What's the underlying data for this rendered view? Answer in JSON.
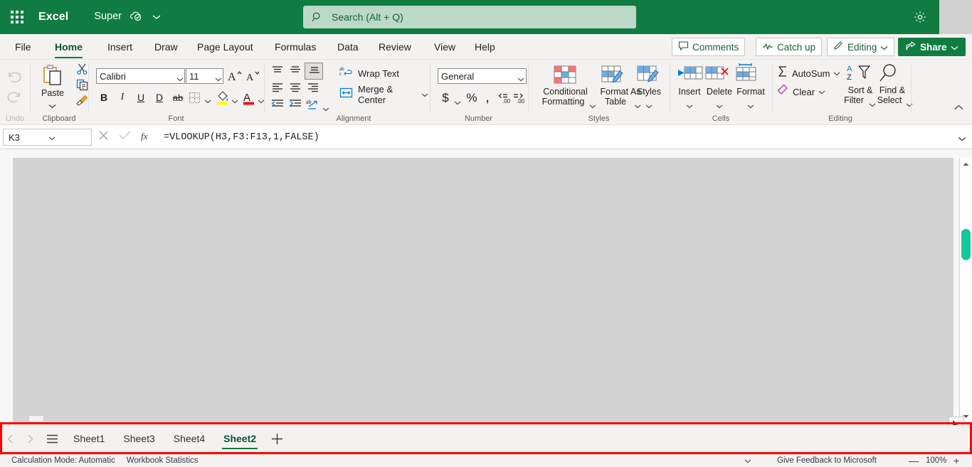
{
  "titlebar": {
    "app_name": "Excel",
    "document_name": "Super",
    "waffle_icon": "app-launcher-icon",
    "cloud_icon": "cloud-saved-icon",
    "caret_icon": "chevron-down-icon",
    "gear_icon": "settings-gear-icon",
    "brand_color": "#107c41"
  },
  "search": {
    "placeholder": "Search (Alt + Q)",
    "value": "",
    "icon": "search-icon"
  },
  "ribbon_tabs": [
    {
      "label": "File",
      "active": false
    },
    {
      "label": "Home",
      "active": true
    },
    {
      "label": "Insert",
      "active": false
    },
    {
      "label": "Draw",
      "active": false
    },
    {
      "label": "Page Layout",
      "active": false
    },
    {
      "label": "Formulas",
      "active": false
    },
    {
      "label": "Data",
      "active": false
    },
    {
      "label": "Review",
      "active": false
    },
    {
      "label": "View",
      "active": false
    },
    {
      "label": "Help",
      "active": false
    }
  ],
  "header_actions": {
    "comments": "Comments",
    "comments_icon": "comment-bubble-icon",
    "catch_up": "Catch up",
    "catch_up_icon": "activity-pulse-icon",
    "editing": "Editing",
    "editing_icon": "pencil-icon",
    "editing_caret": "chevron-down-icon",
    "share": "Share",
    "share_icon": "share-arrow-icon",
    "share_caret": "chevron-down-icon"
  },
  "ribbon": {
    "undo": {
      "group_label": "Undo",
      "undo_icon": "undo-arrow-icon",
      "redo_icon": "redo-arrow-icon"
    },
    "clipboard": {
      "group_label": "Clipboard",
      "paste_label": "Paste",
      "paste_icon": "paste-clipboard-icon",
      "paste_caret": "chevron-down-icon",
      "cut_icon": "scissors-icon",
      "copy_icon": "copy-pages-icon",
      "format_painter_icon": "format-painter-brush-icon"
    },
    "font": {
      "group_label": "Font",
      "font_family": "Calibri",
      "font_size": "11",
      "grow_font_icon": "increase-font-size-icon",
      "shrink_font_icon": "decrease-font-size-icon",
      "bold": "B",
      "italic": "I",
      "underline": "U",
      "double_underline": "D",
      "strikethrough": "ab",
      "borders_icon": "borders-icon",
      "borders_caret": "chevron-down-icon",
      "fill_color_icon": "fill-color-bucket-icon",
      "fill_color_caret": "chevron-down-icon",
      "fill_color_value": "#ffff00",
      "font_color_icon": "font-color-icon",
      "font_color_caret": "chevron-down-icon",
      "font_color_value": "#e81123"
    },
    "alignment": {
      "group_label": "Alignment",
      "align_top_icon": "align-top-icon",
      "align_middle_icon": "align-middle-icon",
      "align_bottom_icon": "align-bottom-icon",
      "align_left_icon": "align-left-icon",
      "align_center_icon": "align-center-icon",
      "align_right_icon": "align-right-icon",
      "decrease_indent_icon": "decrease-indent-icon",
      "increase_indent_icon": "increase-indent-icon",
      "orientation_icon": "text-orientation-icon",
      "orientation_caret": "chevron-down-icon",
      "wrap_text": "Wrap Text",
      "wrap_text_icon": "wrap-text-icon",
      "merge_center": "Merge & Center",
      "merge_center_icon": "merge-cells-icon",
      "merge_caret": "chevron-down-icon"
    },
    "number": {
      "group_label": "Number",
      "format": "General",
      "currency_icon": "currency-dollar-icon",
      "currency_caret": "chevron-down-icon",
      "percent_icon": "percent-style-icon",
      "comma_icon": "comma-style-icon",
      "increase_decimal_icon": "increase-decimal-icon",
      "decrease_decimal_icon": "decrease-decimal-icon"
    },
    "styles": {
      "group_label": "Styles",
      "conditional_formatting_line1": "Conditional",
      "conditional_formatting_line2": "Formatting",
      "conditional_formatting_icon": "conditional-formatting-icon",
      "conditional_caret": "chevron-down-icon",
      "format_as_table_line1": "Format As",
      "format_as_table_line2": "Table",
      "format_as_table_icon": "format-as-table-icon",
      "format_table_caret": "chevron-down-icon",
      "cell_styles": "Styles",
      "cell_styles_icon": "cell-styles-icon",
      "cell_styles_caret": "chevron-down-icon"
    },
    "cells": {
      "group_label": "Cells",
      "insert": "Insert",
      "insert_icon": "insert-cells-icon",
      "insert_caret": "chevron-down-icon",
      "delete": "Delete",
      "delete_icon": "delete-cells-icon",
      "delete_caret": "chevron-down-icon",
      "format": "Format",
      "format_icon": "format-cells-icon",
      "format_caret": "chevron-down-icon"
    },
    "editing": {
      "group_label": "Editing",
      "autosum": "AutoSum",
      "autosum_icon": "sigma-autosum-icon",
      "autosum_caret": "chevron-down-icon",
      "clear": "Clear",
      "clear_icon": "eraser-clear-icon",
      "clear_caret": "chevron-down-icon",
      "sort_filter_line1": "Sort &",
      "sort_filter_line2": "Filter",
      "sort_filter_icon": "sort-filter-icon",
      "sort_filter_caret": "chevron-down-icon",
      "find_select_line1": "Find &",
      "find_select_line2": "Select",
      "find_select_icon": "find-select-magnifier-icon",
      "find_select_caret": "chevron-down-icon"
    },
    "collapse_icon": "chevron-up-icon"
  },
  "formula_bar": {
    "name_box": "K3",
    "name_box_caret": "chevron-down-icon",
    "cancel_icon": "cancel-x-icon",
    "confirm_icon": "confirm-check-icon",
    "fx_icon": "insert-function-fx-icon",
    "formula": "=VLOOKUP(H3,F3:F13,1,FALSE)",
    "expand_icon": "chevron-down-icon"
  },
  "grid": {
    "vscroll_up_icon": "scroll-up-arrow-icon",
    "vscroll_down_icon": "scroll-down-arrow-icon",
    "vthumb_color": "#16c79a"
  },
  "sheet_bar": {
    "prev_icon": "chevron-left-icon",
    "next_icon": "chevron-right-icon",
    "all_sheets_icon": "hamburger-all-sheets-icon",
    "tabs": [
      {
        "label": "Sheet1",
        "active": false
      },
      {
        "label": "Sheet3",
        "active": false
      },
      {
        "label": "Sheet4",
        "active": false
      },
      {
        "label": "Sheet2",
        "active": true
      }
    ],
    "add_sheet_icon": "plus-add-sheet-icon",
    "add_sheet_label": "+"
  },
  "status_bar": {
    "calculation_mode": "Calculation Mode: Automatic",
    "workbook_statistics": "Workbook Statistics",
    "caret_icon": "chevron-down-icon",
    "feedback": "Give Feedback to Microsoft",
    "zoom_out_label": "—",
    "zoom_out_icon": "zoom-out-icon",
    "zoom_level": "100%",
    "zoom_in_label": "+",
    "zoom_in_icon": "zoom-in-icon"
  },
  "annotation": {
    "color": "#ff0000",
    "target": "sheet-tab-bar"
  }
}
